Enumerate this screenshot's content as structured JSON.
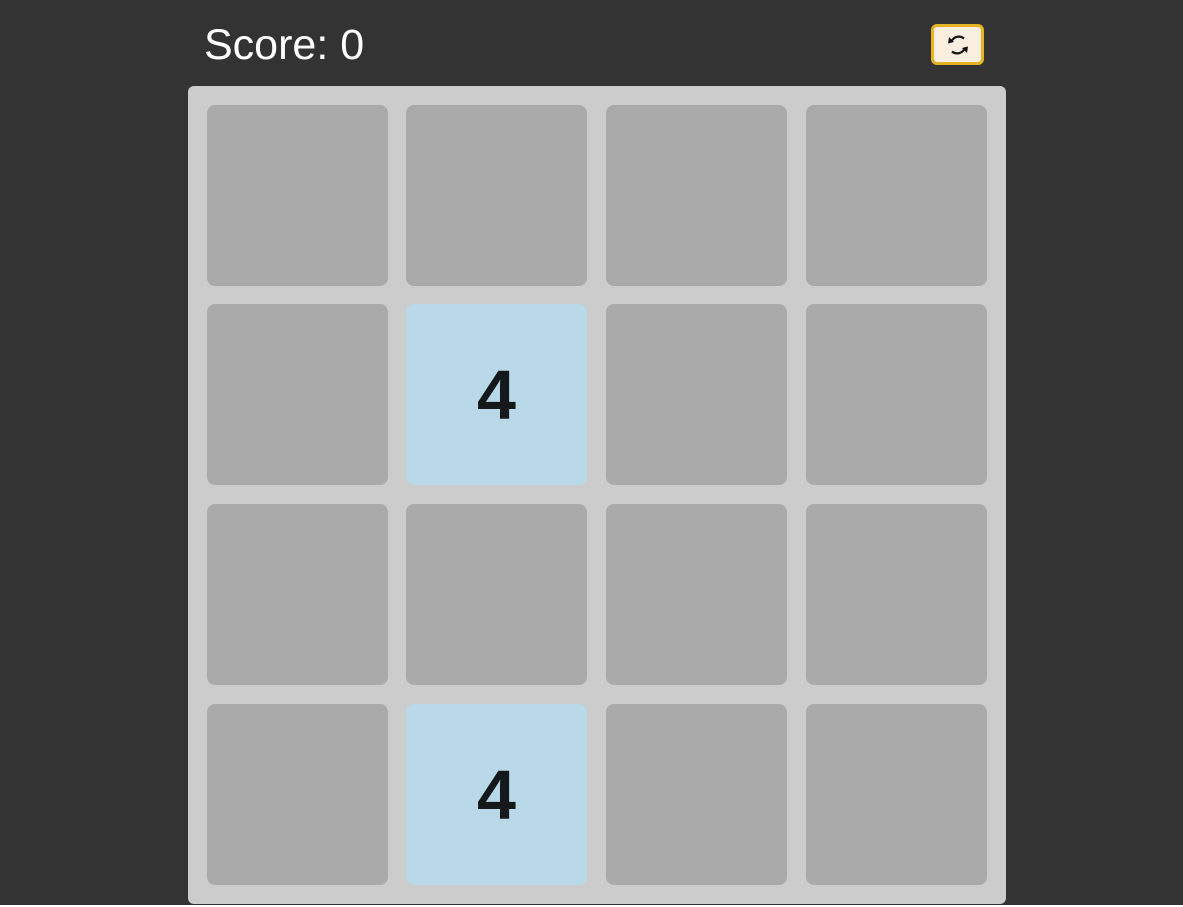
{
  "header": {
    "score_label": "Score: 0",
    "restart_icon": "refresh-icon"
  },
  "colors": {
    "background": "#333333",
    "board": "#cccccc",
    "empty_tile": "#aaaaaa",
    "tile_4": "#b9d8e8",
    "tile_text": "#15191c",
    "restart_border": "#e6b422",
    "restart_fill": "#faeee0"
  },
  "board": {
    "size": 4,
    "cells": [
      [
        "",
        "",
        "",
        ""
      ],
      [
        "",
        "4",
        "",
        ""
      ],
      [
        "",
        "",
        "",
        ""
      ],
      [
        "",
        "4",
        "",
        ""
      ]
    ]
  }
}
